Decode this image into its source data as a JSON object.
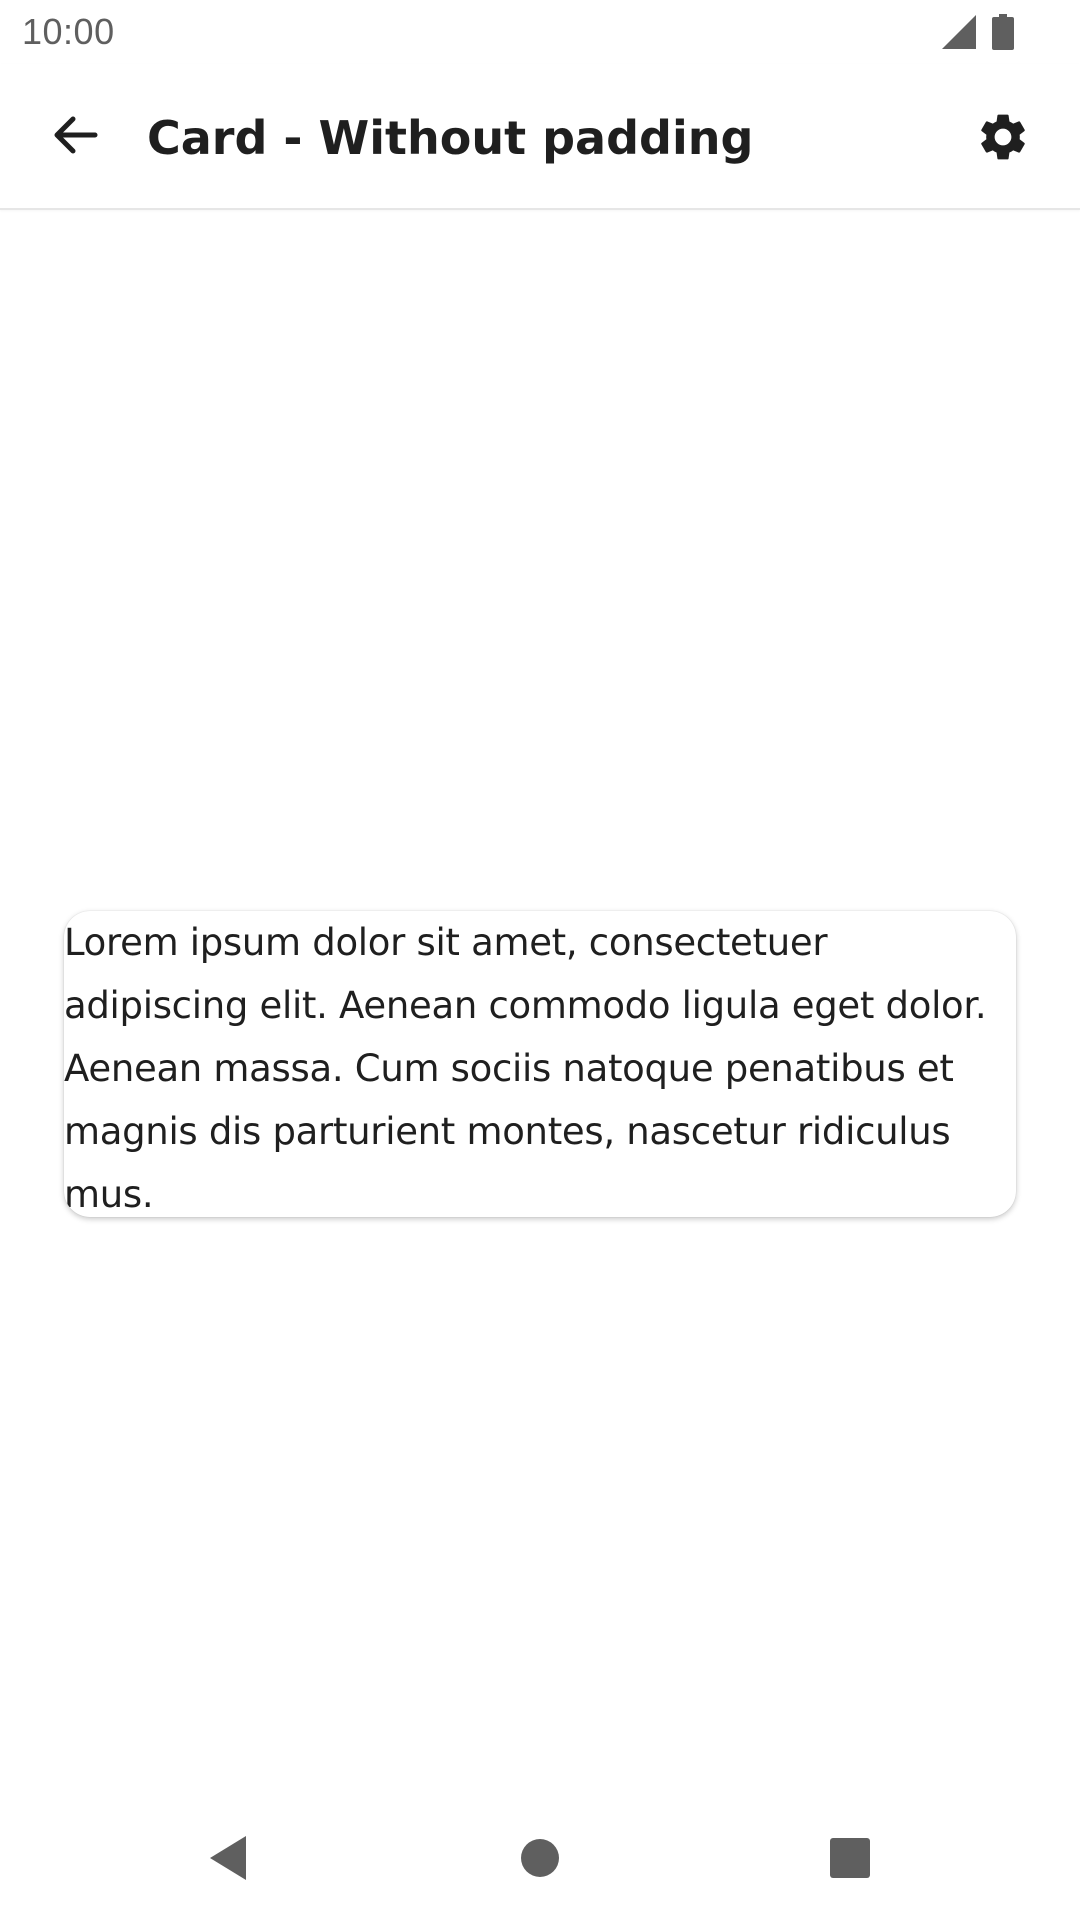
{
  "status_bar": {
    "time": "10:00",
    "icons": [
      "cellular-signal-icon",
      "battery-icon"
    ]
  },
  "app_bar": {
    "title": "Card - Without padding",
    "back_icon": "arrow-back-icon",
    "settings_icon": "gear-icon"
  },
  "card": {
    "text": "Lorem ipsum dolor sit amet, consectetuer adipiscing elit. Aenean commodo ligula eget dolor. Aenean massa. Cum sociis natoque penatibus et magnis dis parturient montes, nascetur ridiculus mus."
  },
  "nav_bar": {
    "icons": [
      "nav-back-icon",
      "nav-home-icon",
      "nav-recents-icon"
    ]
  },
  "colors": {
    "text": "#1f1f1f",
    "status_text": "#5f5f5f",
    "background": "#ffffff",
    "nav_icons": "#5f5f5f"
  }
}
